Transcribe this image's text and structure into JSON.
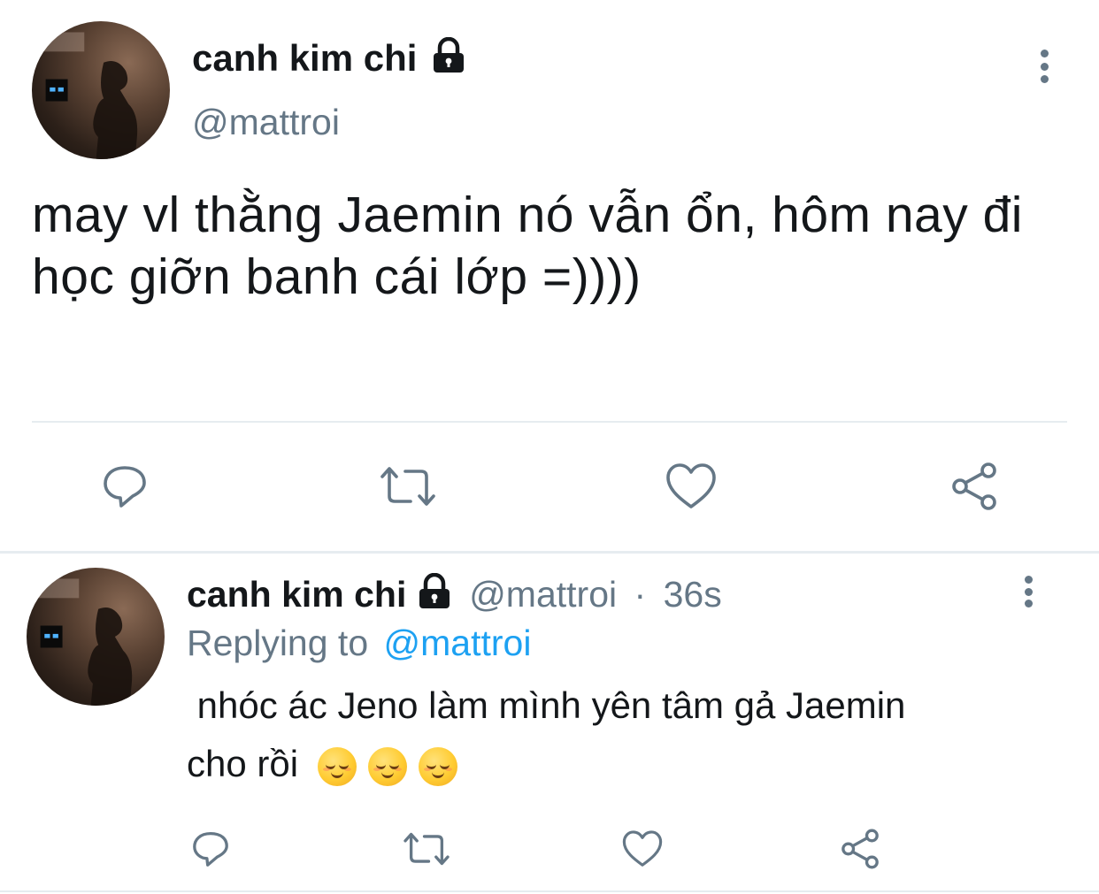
{
  "main_tweet": {
    "display_name": "canh kim chi",
    "handle": "@mattroi",
    "text": "may vl thằng Jaemin nó vẫn ổn, hôm nay đi học giỡn banh cái lớp =))))",
    "actions": [
      {
        "name": "reply",
        "icon": "reply-icon"
      },
      {
        "name": "retweet",
        "icon": "retweet-icon"
      },
      {
        "name": "like",
        "icon": "heart-icon"
      },
      {
        "name": "share",
        "icon": "share-icon"
      }
    ]
  },
  "reply_tweet": {
    "display_name": "canh kim chi",
    "handle": "@mattroi",
    "separator": "·",
    "time": "36s",
    "replying_label": "Replying to",
    "replying_to": "@mattroi",
    "text_line1": " nhóc ác Jeno làm mình yên tâm gả Jaemin",
    "text_line2": "cho rồi",
    "emojis": [
      "relieved-face-emoji",
      "relieved-face-emoji",
      "relieved-face-emoji"
    ]
  },
  "colors": {
    "text": "#14171a",
    "secondary": "#657786",
    "link": "#1da1f2",
    "divider": "#e6ecf0"
  }
}
